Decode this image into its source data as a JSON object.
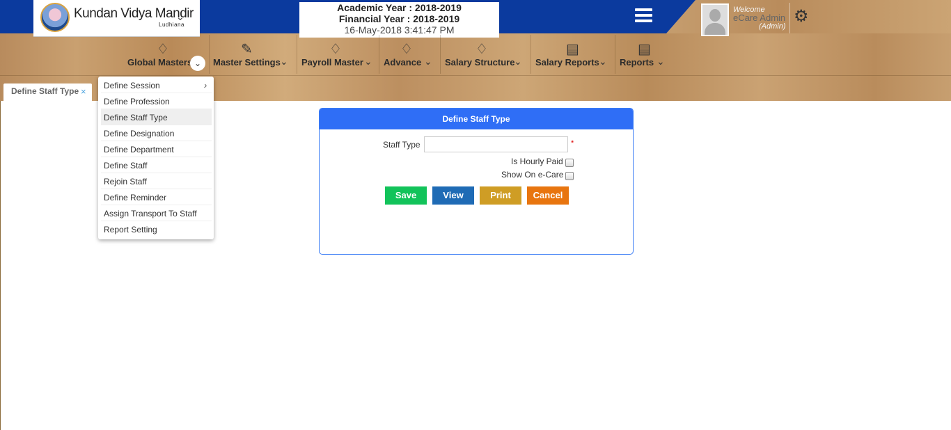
{
  "header": {
    "school_name": "Kundan Vidya Mandir",
    "school_city": "Ludhiana",
    "academic_year": "Academic Year : 2018-2019",
    "financial_year": "Financial Year : 2018-2019",
    "datetime": "16-May-2018 3:41:47 PM",
    "welcome": "Welcome",
    "user_name": "eCare Admin",
    "user_role": "(Admin)"
  },
  "menu": [
    {
      "label": "Global Masters",
      "icon": "global-masters-icon"
    },
    {
      "label": "Master Settings",
      "icon": "master-settings-icon"
    },
    {
      "label": "Payroll Master",
      "icon": "payroll-master-icon"
    },
    {
      "label": "Advance",
      "icon": "advance-icon"
    },
    {
      "label": "Salary Structure",
      "icon": "salary-structure-icon"
    },
    {
      "label": "Salary Reports",
      "icon": "salary-reports-icon"
    },
    {
      "label": "Reports",
      "icon": "reports-icon"
    }
  ],
  "tab": {
    "label": "Define Staff Type",
    "close": "×"
  },
  "dropdown": [
    {
      "label": "Define Session"
    },
    {
      "label": "Define Profession"
    },
    {
      "label": "Define Staff Type"
    },
    {
      "label": "Define Designation"
    },
    {
      "label": "Define Department"
    },
    {
      "label": "Define Staff"
    },
    {
      "label": "Rejoin Staff"
    },
    {
      "label": "Define Reminder"
    },
    {
      "label": "Assign Transport To Staff"
    },
    {
      "label": "Report Setting"
    }
  ],
  "form": {
    "title": "Define Staff Type",
    "staff_type_label": "Staff Type",
    "staff_type_value": "",
    "required_mark": "*",
    "hourly_label": "Is Hourly Paid",
    "ecare_label": "Show On e-Care",
    "save": "Save",
    "view": "View",
    "print": "Print",
    "cancel": "Cancel"
  },
  "colors": {
    "top_bar": "#0b3a9e",
    "panel_header": "#2f6ef6",
    "save": "#12c35a",
    "view": "#1f6bb5",
    "print": "#cf9d25",
    "cancel": "#e8750f"
  }
}
